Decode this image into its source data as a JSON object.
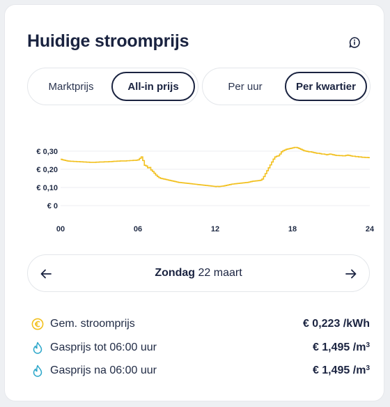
{
  "header": {
    "title": "Huidige stroomprijs",
    "info_icon": "info-icon"
  },
  "price_toggle": {
    "options": [
      "Marktprijs",
      "All-in prijs"
    ],
    "selected": "All-in prijs"
  },
  "interval_toggle": {
    "options": [
      "Per uur",
      "Per kwartier"
    ],
    "selected": "Per kwartier"
  },
  "chart_data": {
    "type": "line",
    "title": "",
    "xlabel": "",
    "ylabel": "",
    "ylim": [
      0,
      0.33
    ],
    "xlim": [
      0,
      24
    ],
    "y_ticks": [
      "€ 0,30",
      "€ 0,20",
      "€ 0,10",
      "€ 0"
    ],
    "y_tick_values": [
      0.3,
      0.2,
      0.1,
      0
    ],
    "x_ticks": [
      "00",
      "06",
      "12",
      "18",
      "24"
    ],
    "x_tick_values": [
      0,
      6,
      12,
      18,
      24
    ],
    "grid": true,
    "line_style": "step",
    "color": "#f2c01e",
    "series": [
      {
        "values": [
          0.255,
          0.252,
          0.25,
          0.248,
          0.246,
          0.245,
          0.244,
          0.244,
          0.243,
          0.243,
          0.242,
          0.242,
          0.241,
          0.241,
          0.24,
          0.24,
          0.239,
          0.239,
          0.238,
          0.238,
          0.238,
          0.238,
          0.239,
          0.239,
          0.24,
          0.24,
          0.24,
          0.241,
          0.241,
          0.241,
          0.242,
          0.242,
          0.243,
          0.244,
          0.244,
          0.245,
          0.245,
          0.246,
          0.246,
          0.246,
          0.246,
          0.247,
          0.247,
          0.248,
          0.248,
          0.249,
          0.249,
          0.25,
          0.252,
          0.26,
          0.268,
          0.248,
          0.222,
          0.218,
          0.208,
          0.21,
          0.196,
          0.188,
          0.178,
          0.168,
          0.16,
          0.154,
          0.15,
          0.148,
          0.146,
          0.144,
          0.142,
          0.14,
          0.138,
          0.136,
          0.134,
          0.132,
          0.13,
          0.128,
          0.127,
          0.126,
          0.125,
          0.124,
          0.123,
          0.122,
          0.121,
          0.12,
          0.119,
          0.118,
          0.117,
          0.116,
          0.115,
          0.114,
          0.113,
          0.112,
          0.111,
          0.11,
          0.109,
          0.108,
          0.107,
          0.106,
          0.105,
          0.106,
          0.105,
          0.106,
          0.107,
          0.108,
          0.11,
          0.112,
          0.114,
          0.116,
          0.118,
          0.119,
          0.12,
          0.121,
          0.122,
          0.123,
          0.124,
          0.125,
          0.126,
          0.127,
          0.128,
          0.13,
          0.132,
          0.134,
          0.135,
          0.136,
          0.137,
          0.138,
          0.14,
          0.146,
          0.16,
          0.176,
          0.192,
          0.208,
          0.224,
          0.24,
          0.256,
          0.268,
          0.272,
          0.274,
          0.284,
          0.296,
          0.302,
          0.306,
          0.31,
          0.312,
          0.314,
          0.316,
          0.318,
          0.32,
          0.32,
          0.318,
          0.314,
          0.31,
          0.306,
          0.302,
          0.3,
          0.298,
          0.296,
          0.296,
          0.294,
          0.292,
          0.29,
          0.288,
          0.288,
          0.286,
          0.284,
          0.284,
          0.282,
          0.28,
          0.282,
          0.284,
          0.282,
          0.28,
          0.278,
          0.276,
          0.276,
          0.275,
          0.275,
          0.274,
          0.274,
          0.276,
          0.278,
          0.276,
          0.274,
          0.272,
          0.272,
          0.27,
          0.27,
          0.268,
          0.268,
          0.266,
          0.266,
          0.265,
          0.265,
          0.264
        ]
      }
    ]
  },
  "date_nav": {
    "day": "Zondag",
    "date": "22 maart",
    "prev_icon": "arrow-left-icon",
    "next_icon": "arrow-right-icon"
  },
  "stats": [
    {
      "icon": "euro-icon",
      "label": "Gem. stroomprijs",
      "value": "€ 0,223 /kWh",
      "suffix_sup": ""
    },
    {
      "icon": "flame-icon",
      "label": "Gasprijs tot 06:00 uur",
      "value": "€ 1,495 /m",
      "suffix_sup": "3"
    },
    {
      "icon": "flame-icon",
      "label": "Gasprijs na 06:00 uur",
      "value": "€ 1,495 /m",
      "suffix_sup": "3"
    }
  ],
  "colors": {
    "accent": "#f2c01e",
    "flame": "#2aa6c9",
    "text": "#1a2340"
  }
}
